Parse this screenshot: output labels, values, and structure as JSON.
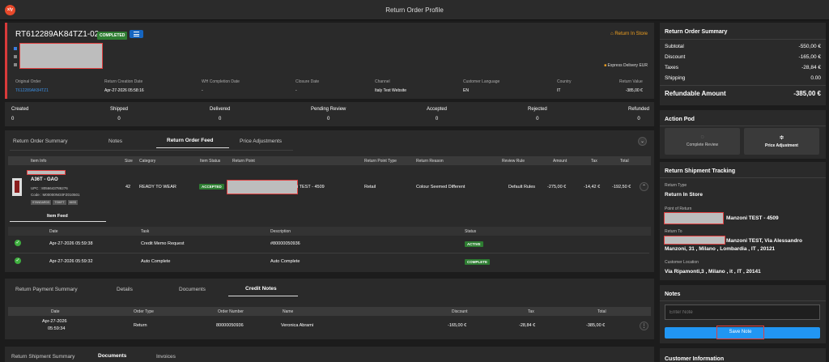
{
  "app": {
    "logo": "x/y",
    "title": "Return Order Profile"
  },
  "header": {
    "order_id": "RT612289AK84TZ1-02",
    "status": "COMPLETED",
    "return_type": "Return In Store",
    "delivery": "Express Delivery",
    "currency": "EUR",
    "columns": [
      {
        "label": "Original Order",
        "value": "T612289AK84TZ1"
      },
      {
        "label": "Return Creation Date",
        "value": "Apr-27-2026 05:58:16"
      },
      {
        "label": "WH Completion Date",
        "value": "-"
      },
      {
        "label": "Closure Date",
        "value": "-"
      },
      {
        "label": "Channel",
        "value": "Italy Test Website"
      },
      {
        "label": "Customer Language",
        "value": "EN"
      },
      {
        "label": "Country",
        "value": "IT"
      },
      {
        "label": "Return Value",
        "value": "-385,00 €"
      }
    ]
  },
  "stats": [
    {
      "label": "Created",
      "value": "0"
    },
    {
      "label": "Shipped",
      "value": "0"
    },
    {
      "label": "Delivered",
      "value": "0"
    },
    {
      "label": "Pending Review",
      "value": "0"
    },
    {
      "label": "Accepted",
      "value": "0"
    },
    {
      "label": "Rejected",
      "value": "0"
    },
    {
      "label": "Refunded",
      "value": "0"
    }
  ],
  "mid_tabs": [
    "Return Order Summary",
    "Notes",
    "Return Order Feed",
    "Price Adjustments"
  ],
  "items_table": {
    "headers": [
      "Item Info",
      "Size",
      "Category",
      "Item Status",
      "Return Point",
      "Return Point Type",
      "Return Reason",
      "Review Rule",
      "Amount",
      "Tax",
      "Total"
    ],
    "row": {
      "name": "A36T - GAO",
      "upc": "UPC : 8056643786276",
      "code": "Code : M00000NG0FZ010501",
      "chips": [
        "STANDARDS",
        "TSHIFT",
        "MISS"
      ],
      "size": "42",
      "category": "READY TO WEAR",
      "status": "ACCEPTED",
      "return_point": "i TEST - 4509",
      "return_point_type": "Retail",
      "reason": "Colour Seemed Different",
      "rule": "Default Rules",
      "amount": "-275,00 €",
      "tax": "-14,42 €",
      "total": "-192,50 €"
    }
  },
  "item_feed": {
    "tab": "Item Feed",
    "headers": [
      "Date",
      "Task",
      "Description",
      "Status"
    ],
    "rows": [
      {
        "date": "Apr-27-2026 05:59:38",
        "task": "Credit Memo Request",
        "description": "#80000050936",
        "status": "ACTIVE"
      },
      {
        "date": "Apr-27-2026 05:59:32",
        "task": "Auto Complete",
        "description": "Auto Complete",
        "status": "COMPLETE"
      }
    ]
  },
  "bottom_tabs": [
    "Return Payment Summary",
    "Details",
    "Documents",
    "Credit Notes"
  ],
  "credit_notes": {
    "headers": [
      "Date",
      "Order Type",
      "Order Number",
      "Name",
      "Discount",
      "Tax",
      "Total"
    ],
    "row": {
      "date_line1": "Apr-27-2026",
      "date_line2": "05:59:34",
      "type": "Return",
      "number": "80000050936",
      "name": "Veronica Abrami",
      "discount": "-165,00 €",
      "tax": "-28,84 €",
      "total": "-385,00 €"
    }
  },
  "last_tabs": [
    "Return Shipment Summary",
    "Documents",
    "Invoices"
  ],
  "summary": {
    "title": "Return Order Summary",
    "rows": [
      {
        "label": "Subtotal",
        "value": "-550,00 €"
      },
      {
        "label": "Discount",
        "value": "-165,00 €"
      },
      {
        "label": "Taxes",
        "value": "-28,84 €"
      },
      {
        "label": "Shipping",
        "value": "0.00"
      }
    ],
    "refund_label": "Refundable Amount",
    "refund_value": "-385,00 €"
  },
  "action_pod": {
    "title": "Action Pod",
    "complete_review": "Complete Review",
    "price_adjustment": "Price Adjustment"
  },
  "tracking": {
    "title": "Return Shipment Tracking",
    "type_label": "Return Type",
    "type_value": "Return In Store",
    "point_label": "Point of Return",
    "point_value": "Manzoni TEST - 4509",
    "to_label": "Return To",
    "to_value_1": "Manzoni TEST, Via Alessandro",
    "to_value_2": "Manzoni, 31 , Milano , Lombardia , IT , 20121",
    "cust_label": "Customer Location",
    "cust_value": "Via Ripamonti,3 , Milano , it , IT , 20141"
  },
  "notes": {
    "title": "Notes",
    "placeholder": "Enter Note",
    "save": "Save Note"
  },
  "customer": {
    "title": "Customer Information"
  }
}
